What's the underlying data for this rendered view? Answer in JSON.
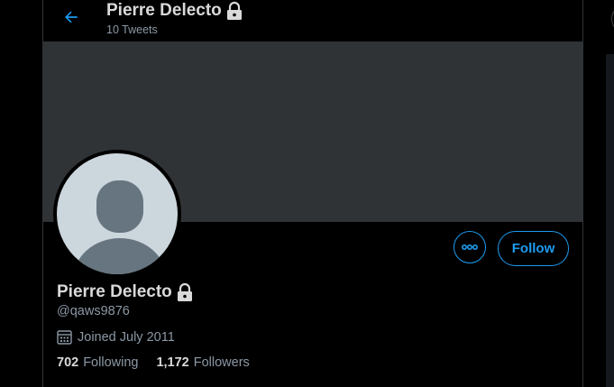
{
  "header": {
    "title": "Pierre Delecto",
    "tweet_count": "10 Tweets"
  },
  "profile": {
    "name": "Pierre Delecto",
    "handle": "@qaws9876",
    "joined": "Joined July 2011",
    "follow_label": "Follow",
    "stats": {
      "following_count": "702",
      "following_label": "Following",
      "followers_count": "1,172",
      "followers_label": "Followers"
    }
  },
  "icons": [
    "back-arrow-icon",
    "lock-icon",
    "more-icon",
    "calendar-icon",
    "default-avatar-icon"
  ],
  "colors": {
    "accent": "#1d9bf0",
    "background": "#000000",
    "banner": "#2f3336",
    "secondary_text": "#8b98a5"
  }
}
